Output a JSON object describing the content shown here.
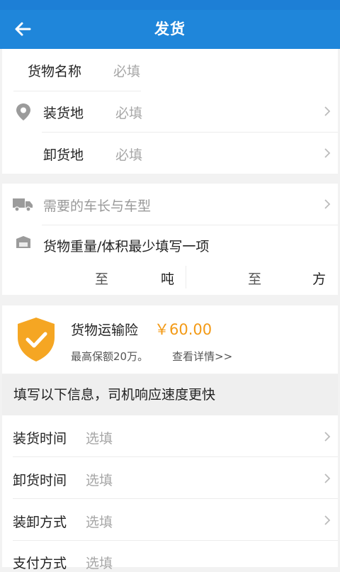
{
  "header": {
    "title": "发货",
    "back_icon": "arrow-left-icon"
  },
  "cargo": {
    "name_label": "货物名称",
    "name_placeholder": "必填",
    "load_label": "装货地",
    "load_placeholder": "必填",
    "unload_label": "卸货地",
    "unload_placeholder": "必填"
  },
  "vehicle": {
    "vehicle_label": "需要的车长与车型",
    "weight_volume_label": "货物重量/体积最少填写一项",
    "weight_range_sep": "至",
    "weight_unit": "吨",
    "volume_range_sep": "至",
    "volume_unit": "方"
  },
  "insurance": {
    "title": "货物运输险",
    "price": "￥60.00",
    "desc": "最高保额20万。",
    "link": "查看详情>>",
    "badge_color": "#f5a623"
  },
  "optional": {
    "section_title": "填写以下信息，司机响应速度更快",
    "items": [
      {
        "label": "装货时间",
        "placeholder": "选填"
      },
      {
        "label": "卸货时间",
        "placeholder": "选填"
      },
      {
        "label": "装卸方式",
        "placeholder": "选填"
      },
      {
        "label": "支付方式",
        "placeholder": "选填"
      }
    ]
  },
  "colors": {
    "primary": "#1f86da",
    "accent": "#f39a16"
  }
}
